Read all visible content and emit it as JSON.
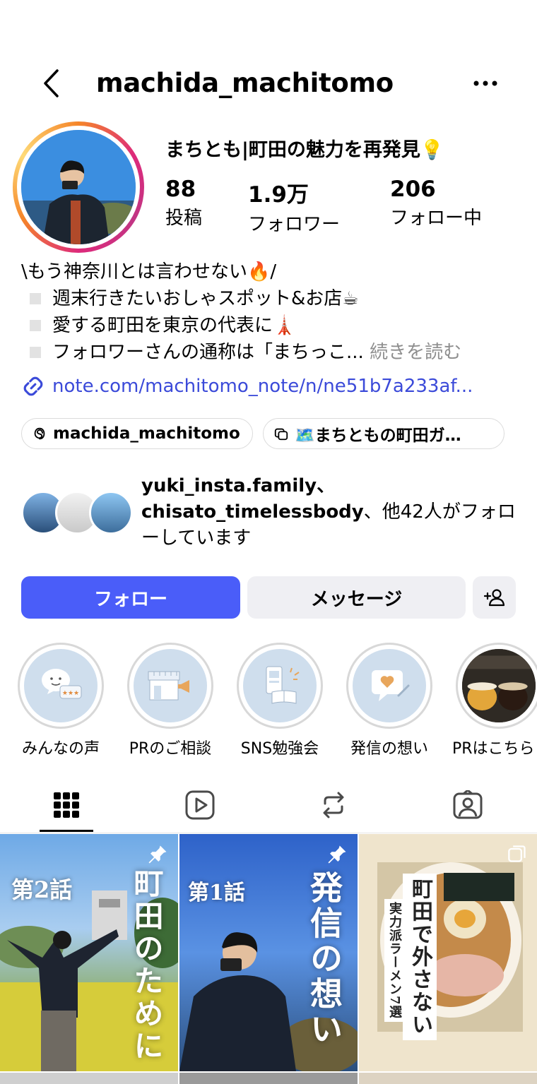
{
  "header": {
    "username": "machida_machitomo"
  },
  "profile": {
    "display_name": "まちとも|町田の魅力を再発見💡",
    "stats": [
      {
        "value": "88",
        "label": "投稿"
      },
      {
        "value": "1.9万",
        "label": "フォロワー"
      },
      {
        "value": "206",
        "label": "フォロー中"
      }
    ],
    "bio": {
      "line1": "\\もう神奈川とは言わせない🔥/",
      "line2": "週末行きたいおしゃスポット&お店☕",
      "line3": "愛する町田を東京の代表に🗼",
      "line4": "フォロワーさんの通称は「まちっこ...",
      "more": "続きを読む"
    },
    "link": "note.com/machitomo_note/n/ne51b7a233af...",
    "pills": [
      {
        "label": "machida_machitomo",
        "icon": "threads-icon"
      },
      {
        "label": "🗺️まちともの町田ガ…",
        "icon": "guide-icon"
      }
    ],
    "mutual": {
      "names": "yuki_insta.family、chisato_timelessbody",
      "suffix": "、他42人がフォローしています"
    }
  },
  "actions": {
    "follow": "フォロー",
    "message": "メッセージ"
  },
  "highlights": [
    {
      "label": "みんなの声"
    },
    {
      "label": "PRのご相談"
    },
    {
      "label": "SNS勉強会"
    },
    {
      "label": "発信の想い"
    },
    {
      "label": "PRはこちら"
    }
  ],
  "posts": [
    {
      "tag": "第2話",
      "title": "町田のために"
    },
    {
      "tag": "第1話",
      "title": "発信の想い"
    },
    {
      "title": "町田で外さない",
      "subtitle": "実力派ラーメン7選"
    }
  ],
  "colors": {
    "accent": "#4a5df9",
    "link": "#3b4ad9",
    "secondary_button": "#efeff3"
  }
}
